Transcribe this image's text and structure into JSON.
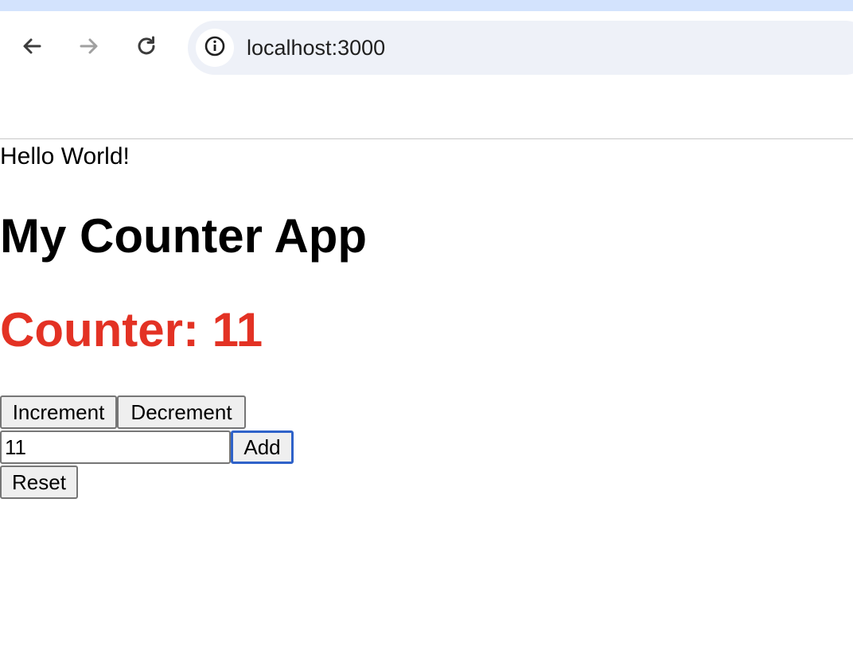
{
  "browser": {
    "url": "localhost:3000",
    "icons": {
      "back": "arrow-left-icon",
      "forward": "arrow-right-icon",
      "reload": "reload-icon",
      "site_info": "info-icon"
    },
    "colors": {
      "top_strip": "#d3e3fd",
      "omnibox": "#eef1f8"
    }
  },
  "page": {
    "hello_text": "Hello World!",
    "title": "My Counter App",
    "counter_text": "Counter: 11",
    "counter_color": "#e33224",
    "buttons": {
      "increment": "Increment",
      "decrement": "Decrement",
      "add": "Add",
      "reset": "Reset"
    },
    "add_input_value": "11"
  }
}
